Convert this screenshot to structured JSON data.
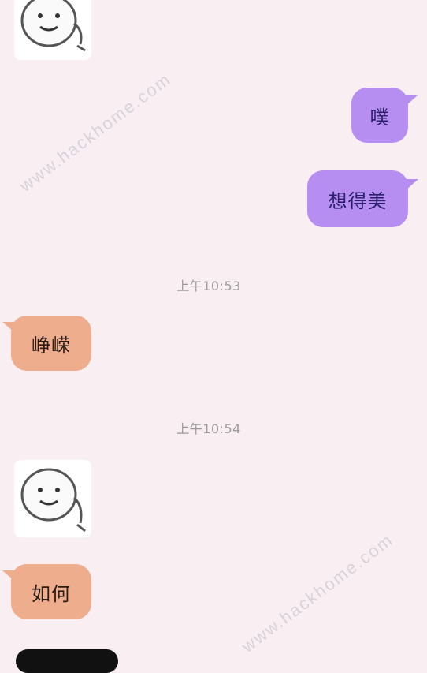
{
  "messages": {
    "me_1": "噗",
    "me_2": "想得美",
    "other_1": "峥嵘",
    "other_2": "如何"
  },
  "timestamps": {
    "t1": "上午10:53",
    "t2": "上午10:54"
  },
  "watermark": {
    "top": "www.hackhome.com",
    "bottom": "www.hackhome.com"
  },
  "colors": {
    "background": "#f9eef2",
    "bubble_me": "#b68df0",
    "bubble_other": "#eeae8e"
  },
  "icons": {
    "sticker": "smiley-face-sticker"
  }
}
